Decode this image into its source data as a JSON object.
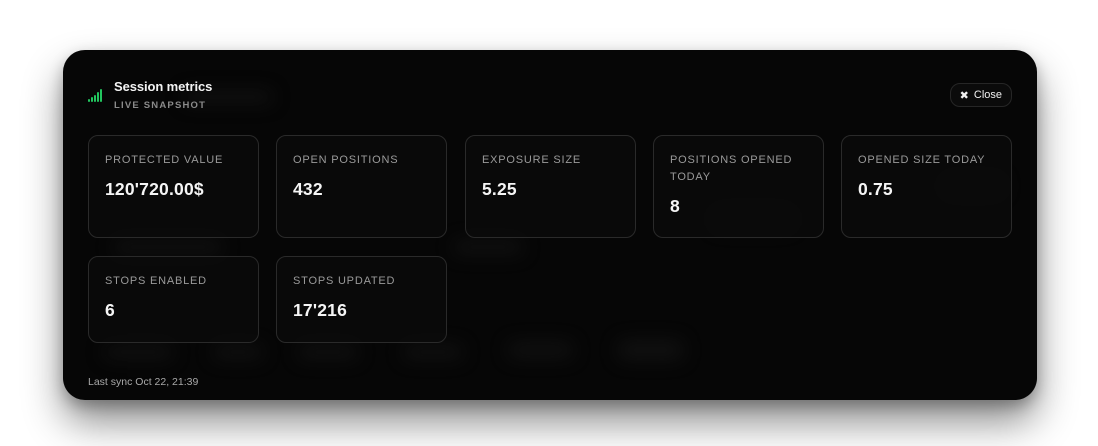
{
  "modal": {
    "title": "Session metrics",
    "subtitle": "LIVE SNAPSHOT",
    "signal_color": "#22c55e",
    "close_label": "Close",
    "close_icon": "close-x-icon"
  },
  "metrics": [
    {
      "label": "PROTECTED VALUE",
      "value": "120'720.00$"
    },
    {
      "label": "OPEN POSITIONS",
      "value": "432"
    },
    {
      "label": "EXPOSURE SIZE",
      "value": "5.25"
    },
    {
      "label": "POSITIONS OPENED TODAY",
      "value": "8"
    },
    {
      "label": "OPENED SIZE TODAY",
      "value": "0.75"
    },
    {
      "label": "STOPS ENABLED",
      "value": "6"
    },
    {
      "label": "STOPS UPDATED",
      "value": "17'216"
    }
  ],
  "footer": {
    "last_sync": "Last sync Oct 22, 21:39"
  }
}
